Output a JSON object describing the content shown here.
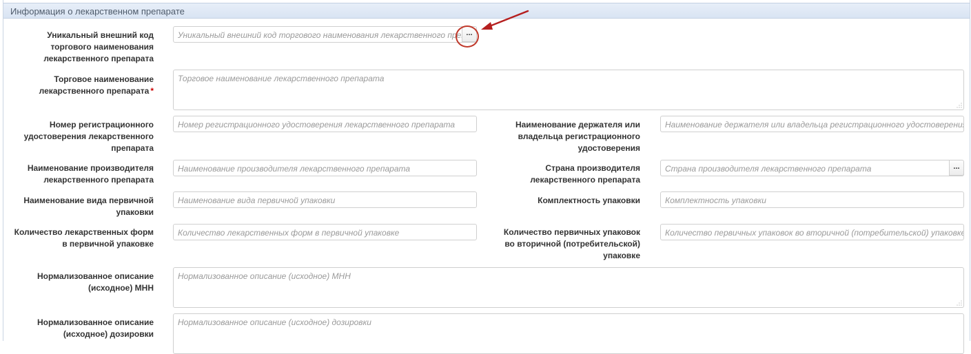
{
  "panel": {
    "title": "Информация о лекарственном препарате"
  },
  "addon_label": "...",
  "required_mark": "*",
  "fields": {
    "unique_code": {
      "label": "Уникальный внешний код торгового наименования лекарственного препарата",
      "placeholder": "Уникальный внешний код торгового наименования лекарственного препарата"
    },
    "trade_name": {
      "label": "Торговое наименование лекарственного препарата",
      "placeholder": "Торговое наименование лекарственного препарата",
      "required": true
    },
    "reg_number": {
      "label": "Номер регистрационного удостоверения лекарственного препарата",
      "placeholder": "Номер регистрационного удостоверения лекарственного препарата"
    },
    "holder_name": {
      "label": "Наименование держателя или владельца регистрационного удостоверения",
      "placeholder": "Наименование держателя или владельца регистрационного удостоверения"
    },
    "manufacturer": {
      "label": "Наименование производителя лекарственного препарата",
      "placeholder": "Наименование производителя лекарственного препарата"
    },
    "country": {
      "label": "Страна производителя лекарственного препарата",
      "placeholder": "Страна производителя лекарственного препарата"
    },
    "primary_package": {
      "label": "Наименование вида первичной упаковки",
      "placeholder": "Наименование вида первичной упаковки"
    },
    "completeness": {
      "label": "Комплектность упаковки",
      "placeholder": "Комплектность упаковки"
    },
    "forms_count": {
      "label": "Количество лекарственных форм в первичной упаковке",
      "placeholder": "Количество лекарственных форм в первичной упаковке"
    },
    "primary_in_secondary": {
      "label": "Количество первичных упаковок во вторичной (потребительской) упаковке",
      "placeholder": "Количество первичных упаковок во вторичной (потребительской) упаковке"
    },
    "inn_description": {
      "label": "Нормализованное описание (исходное) МНН",
      "placeholder": "Нормализованное описание (исходное) МНН"
    },
    "dosage_description": {
      "label": "Нормализованное описание (исходное) дозировки",
      "placeholder": "Нормализованное описание (исходное) дозировки"
    }
  }
}
